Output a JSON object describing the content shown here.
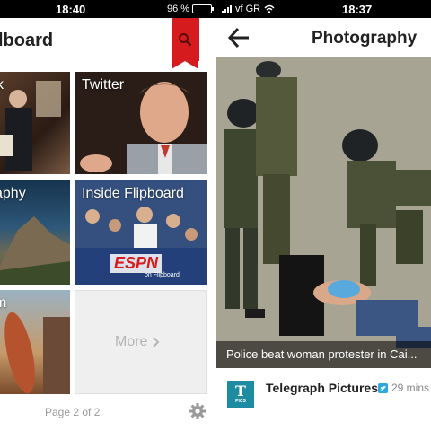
{
  "status_left": {
    "time": "18:40",
    "battery": "96 %",
    "battery_level": 0.96
  },
  "status_right": {
    "carrier": "vf GR",
    "time": "18:37"
  },
  "left_screen": {
    "title": "lboard",
    "search_icon": "search-icon",
    "tiles": [
      {
        "label": "k"
      },
      {
        "label": "Twitter"
      },
      {
        "label": "aphy"
      },
      {
        "label": "Inside Flipboard",
        "badge": "ESPN",
        "badge_sub": "on Flipboard"
      },
      {
        "label": "m"
      }
    ],
    "more_label": "More",
    "page_indicator": "Page 2 of 2",
    "settings_icon": "gear-icon"
  },
  "right_screen": {
    "title": "Photography",
    "back_icon": "back-arrow-icon",
    "caption": "Police beat woman protester in Cai...",
    "source": {
      "logo_letter": "T",
      "logo_sub": "PICS",
      "name": "Telegraph Pictures",
      "time": "29 mins"
    }
  },
  "colors": {
    "accent": "#d61b1f",
    "twitter": "#2ea9df",
    "telegraph": "#1d8ba0"
  }
}
